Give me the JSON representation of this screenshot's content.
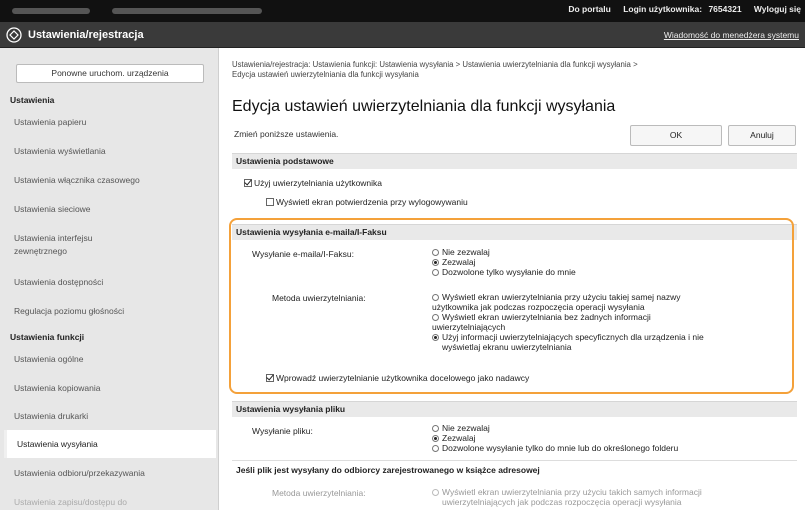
{
  "topbar": {
    "portal_link": "Do portalu",
    "login_label": "Login użytkownika:",
    "login_value": "7654321",
    "logout_link": "Wyloguj się"
  },
  "header": {
    "title": "Ustawienia/rejestracja",
    "message_link": "Wiadomość do menedżera systemu"
  },
  "sidebar": {
    "restart_button": "Ponowne uruchom. urządzenia",
    "section_settings": "Ustawienia",
    "items": [
      "Ustawienia papieru",
      "Ustawienia wyświetlania",
      "Ustawienia włącznika czasowego",
      "Ustawienia sieciowe",
      "Ustawienia interfejsu",
      "zewnętrznego",
      "Ustawienia dostępności",
      "Regulacja poziomu głośności"
    ],
    "section_functions": "Ustawienia funkcji",
    "function_items": [
      "Ustawienia ogólne",
      "Ustawienia kopiowania",
      "Ustawienia drukarki",
      "Ustawienia wysyłania",
      "Ustawienia odbioru/przekazywania",
      "Ustawienia zapisu/dostępu do"
    ]
  },
  "main": {
    "breadcrumb_line1": "Ustawienia/rejestracja: Ustawienia funkcji: Ustawienia wysyłania > Ustawienia uwierzytelniania dla funkcji wysyłania >",
    "breadcrumb_line2": "Edycja ustawień uwierzytelniania dla funkcji wysyłania",
    "title": "Edycja ustawień uwierzytelniania dla funkcji wysyłania",
    "hint": "Zmień poniższe ustawienia.",
    "ok_button": "OK",
    "cancel_button": "Anuluj",
    "basic": {
      "heading": "Ustawienia podstawowe",
      "use_auth": "Użyj uwierzytelniania użytkownika",
      "show_confirm": "Wyświetl ekran potwierdzenia przy wylogowywaniu"
    },
    "email": {
      "heading": "Ustawienia wysyłania e-maila/I-Faksu",
      "send_label": "Wysyłanie e-maila/I-Faksu:",
      "opt_deny": "Nie zezwalaj",
      "opt_allow": "Zezwalaj",
      "opt_only_me": "Dozwolone tylko wysyłanie do mnie",
      "auth_method_label": "Metoda uwierzytelniania:",
      "auth_opt1_l1": "Wyświetl ekran uwierzytelniania przy użyciu takiej samej nazwy",
      "auth_opt1_l2": "użytkownika jak podczas rozpoczęcia operacji wysyłania",
      "auth_opt2_l1": "Wyświetl ekran uwierzytelniania bez żadnych informacji",
      "auth_opt2_l2": "uwierzytelniających",
      "auth_opt3_l1": "Użyj informacji uwierzytelniających specyficznych dla urządzenia i nie",
      "auth_opt3_l2": "wyświetlaj ekranu uwierzytelniania",
      "enter_auth": "Wprowadź uwierzytelnianie użytkownika docelowego jako nadawcy"
    },
    "file": {
      "heading": "Ustawienia wysyłania pliku",
      "send_label": "Wysyłanie pliku:",
      "opt_deny": "Nie zezwalaj",
      "opt_allow": "Zezwalaj",
      "opt_only_me": "Dozwolone wysyłanie tylko do mnie lub do określonego folderu",
      "sub_heading": "Jeśli plik jest wysyłany do odbiorcy zarejestrowanego w książce adresowej",
      "auth_method_label": "Metoda uwierzytelniania:",
      "auth_opt1_l1": "Wyświetl ekran uwierzytelniania przy użyciu takich samych informacji",
      "auth_opt1_l2": "uwierzytelniających jak podczas rozpoczęcia operacji wysyłania"
    }
  }
}
